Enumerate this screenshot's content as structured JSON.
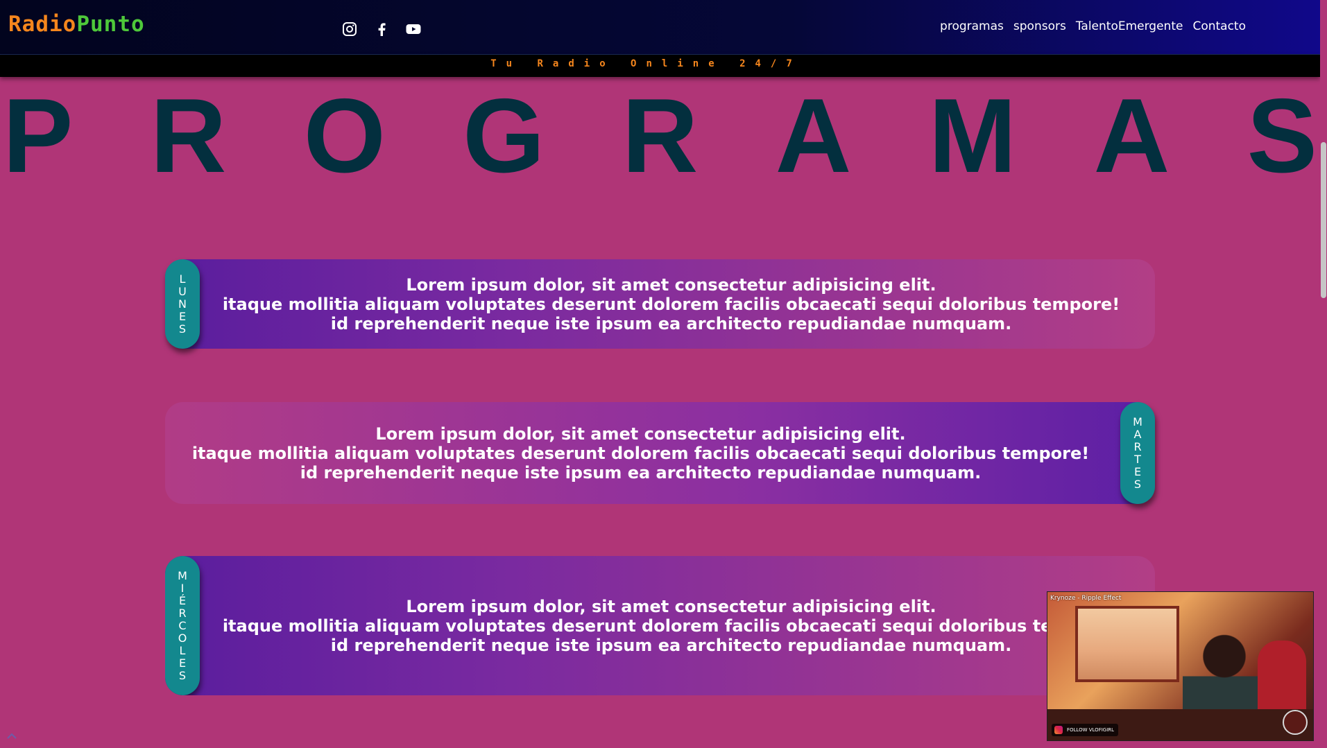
{
  "header": {
    "logo_part1": "Radio",
    "logo_part2": "Punto",
    "socials": [
      "instagram-icon",
      "facebook-icon",
      "youtube-icon"
    ],
    "nav": [
      "programas",
      "sponsors",
      "TalentoEmergente",
      "Contacto"
    ]
  },
  "tagline": "Tu Radio Online 24/7",
  "title_letters": [
    "P",
    "R",
    "O",
    "G",
    "R",
    "A",
    "M",
    "A",
    "S"
  ],
  "programs": [
    {
      "day": "LUNES",
      "tab_side": "left",
      "lines": [
        "Lorem ipsum dolor, sit amet consectetur adipisicing elit.",
        "itaque mollitia aliquam voluptates deserunt dolorem facilis obcaecati sequi doloribus tempore!",
        "id reprehenderit neque iste ipsum ea architecto repudiandae numquam."
      ]
    },
    {
      "day": "MARTES",
      "tab_side": "right",
      "lines": [
        "Lorem ipsum dolor, sit amet consectetur adipisicing elit.",
        "itaque mollitia aliquam voluptates deserunt dolorem facilis obcaecati sequi doloribus tempore!",
        "id reprehenderit neque iste ipsum ea architecto repudiandae numquam."
      ]
    },
    {
      "day": "MIÉRCOLES",
      "tab_side": "left",
      "lines": [
        "Lorem ipsum dolor, sit amet consectetur adipisicing elit.",
        "itaque mollitia aliquam voluptates deserunt dolorem facilis obcaecati sequi doloribus tempore!",
        "id reprehenderit neque iste ipsum ea architecto repudiandae numquam."
      ]
    }
  ],
  "video": {
    "title": "Krynoze - Ripple Effect",
    "follow": "FOLLOW VLOFIGIRL"
  },
  "colors": {
    "background": "#b03577",
    "title": "#032f3e",
    "tab": "#13888e",
    "logo_orange": "#f5861d",
    "logo_green": "#4ec83a"
  }
}
